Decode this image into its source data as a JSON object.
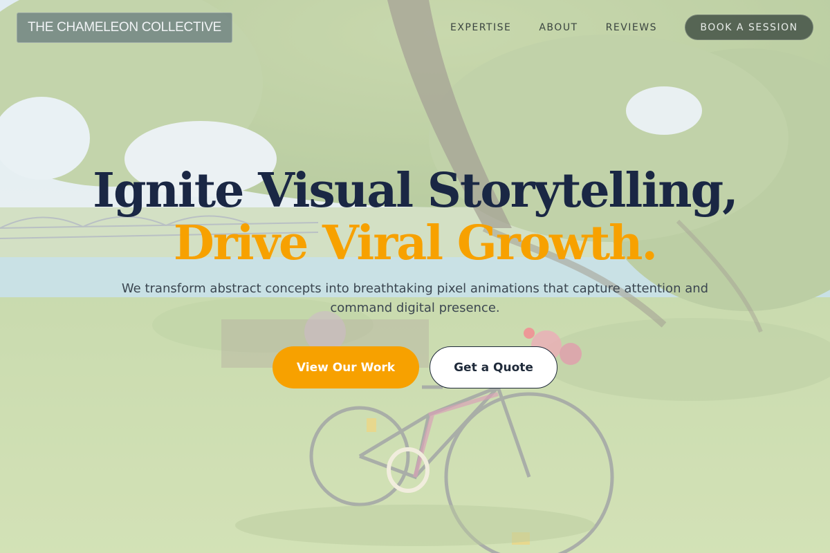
{
  "header": {
    "logo_text": "THE CHAMELEON COLLECTIVE",
    "nav": [
      {
        "label": "EXPERTISE"
      },
      {
        "label": "ABOUT"
      },
      {
        "label": "REVIEWS"
      }
    ],
    "cta_label": "BOOK A SESSION"
  },
  "hero": {
    "headline_line1": "Ignite Visual Storytelling,",
    "headline_line2": "Drive Viral Growth.",
    "subtext": "We transform abstract concepts into breathtaking pixel animations that capture attention and command digital presence.",
    "primary_button": "View Our Work",
    "secondary_button": "Get a Quote"
  },
  "colors": {
    "accent": "#f7a100",
    "headline_dark": "#1a2744",
    "text_body": "#3b4650"
  },
  "background": {
    "icon": "park-scene-photo"
  }
}
